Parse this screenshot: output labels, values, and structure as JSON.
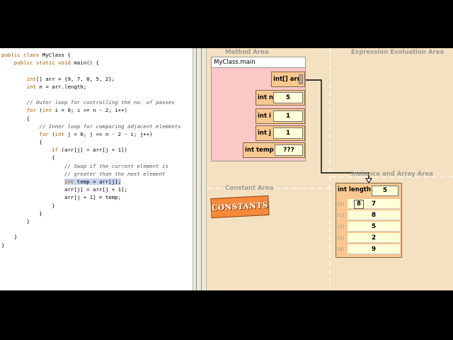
{
  "code": [
    [
      {
        "t": "public class ",
        "c": "kw"
      },
      {
        "t": "MyClass {"
      }
    ],
    [
      {
        "t": "    "
      },
      {
        "t": "public static void ",
        "c": "kw"
      },
      {
        "t": "main() {"
      }
    ],
    [
      {
        "t": ""
      }
    ],
    [
      {
        "t": "        "
      },
      {
        "t": "int",
        "c": "kw"
      },
      {
        "t": "[] arr = {9, 7, 8, 5, 2};"
      }
    ],
    [
      {
        "t": "        "
      },
      {
        "t": "int",
        "c": "kw"
      },
      {
        "t": " n = arr.length;"
      }
    ],
    [
      {
        "t": ""
      }
    ],
    [
      {
        "t": "        "
      },
      {
        "t": "// Outer loop for controlling the no. of passes",
        "c": "cm"
      }
    ],
    [
      {
        "t": "        "
      },
      {
        "t": "for",
        "c": "kw"
      },
      {
        "t": " ("
      },
      {
        "t": "int",
        "c": "kw"
      },
      {
        "t": " i = 0; i <= n - 2; i++)"
      }
    ],
    [
      {
        "t": "        {"
      }
    ],
    [
      {
        "t": "            "
      },
      {
        "t": "// Inner loop for comparing adjacent elements",
        "c": "cm"
      }
    ],
    [
      {
        "t": "            "
      },
      {
        "t": "for",
        "c": "kw"
      },
      {
        "t": " ("
      },
      {
        "t": "int",
        "c": "kw"
      },
      {
        "t": " j = 0; j <= n - 2 - i; j++)"
      }
    ],
    [
      {
        "t": "            {"
      }
    ],
    [
      {
        "t": "                "
      },
      {
        "t": "if",
        "c": "kw"
      },
      {
        "t": " (arr[j] > arr[j + 1])"
      }
    ],
    [
      {
        "t": "                {"
      }
    ],
    [
      {
        "t": "                    "
      },
      {
        "t": "// Swap if the current element is",
        "c": "cm"
      }
    ],
    [
      {
        "t": "                    "
      },
      {
        "t": "// greater than the next element",
        "c": "cm"
      }
    ],
    [
      {
        "t": "                    "
      },
      {
        "t": "int",
        "c": "kw hl"
      },
      {
        "t": " temp = arr[j];",
        "c": "hl"
      }
    ],
    [
      {
        "t": "                    arr[j] = arr[j + 1];"
      }
    ],
    [
      {
        "t": "                    arr[j + 1] = temp;"
      }
    ],
    [
      {
        "t": "                }"
      }
    ],
    [
      {
        "t": "            }"
      }
    ],
    [
      {
        "t": "        }"
      }
    ],
    [
      {
        "t": ""
      }
    ],
    [
      {
        "t": "    }"
      }
    ],
    [
      {
        "t": "}"
      }
    ]
  ],
  "areas": {
    "method": "Method Area",
    "expression": "Expression Evaluation Area",
    "instance": "Instance and Array Area",
    "constant": "Constant Area"
  },
  "frame": {
    "title": "MyClass.main",
    "vars": {
      "arr": {
        "name": "int[] arr",
        "value": ""
      },
      "n": {
        "name": "int n",
        "value": "5"
      },
      "i": {
        "name": "int i",
        "value": "1"
      },
      "j": {
        "name": "int j",
        "value": "1"
      },
      "temp": {
        "name": "int temp",
        "value": "???"
      }
    }
  },
  "constants_label": "CONSTANTS",
  "array": {
    "length_label": "int length",
    "length_value": "5",
    "indices": [
      "[0]",
      "[1]",
      "[2]",
      "[3]",
      "[4]"
    ],
    "values": [
      "7",
      "8",
      "5",
      "2",
      "9"
    ],
    "temp_chip": "8"
  }
}
